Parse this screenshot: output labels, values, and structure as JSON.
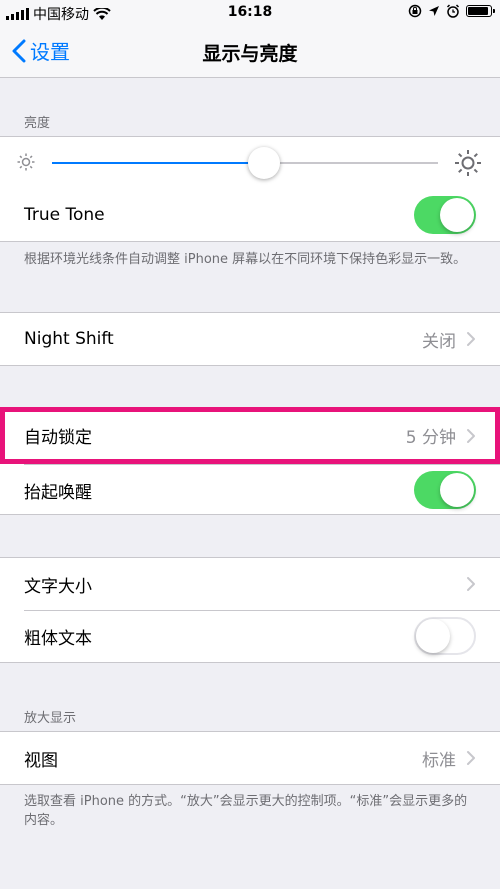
{
  "status": {
    "carrier": "中国移动",
    "time": "16:18",
    "battery_level": 0.9
  },
  "nav": {
    "back_label": "设置",
    "title": "显示与亮度"
  },
  "brightness": {
    "header": "亮度",
    "level": 0.55,
    "true_tone_label": "True Tone",
    "true_tone_on": true,
    "footer": "根据环境光线条件自动调整 iPhone 屏幕以在不同环境下保持色彩显示一致。"
  },
  "night_shift": {
    "label": "Night Shift",
    "value": "关闭"
  },
  "lock": {
    "auto_lock_label": "自动锁定",
    "auto_lock_value": "5 分钟",
    "raise_to_wake_label": "抬起唤醒",
    "raise_to_wake_on": true
  },
  "text": {
    "text_size_label": "文字大小",
    "bold_text_label": "粗体文本",
    "bold_text_on": false
  },
  "zoom": {
    "header": "放大显示",
    "view_label": "视图",
    "view_value": "标准",
    "footer": "选取查看 iPhone 的方式。“放大”会显示更大的控制项。“标准”会显示更多的内容。"
  },
  "colors": {
    "accent": "#007aff",
    "toggle_on": "#4cd964",
    "highlight": "#e8137a"
  }
}
